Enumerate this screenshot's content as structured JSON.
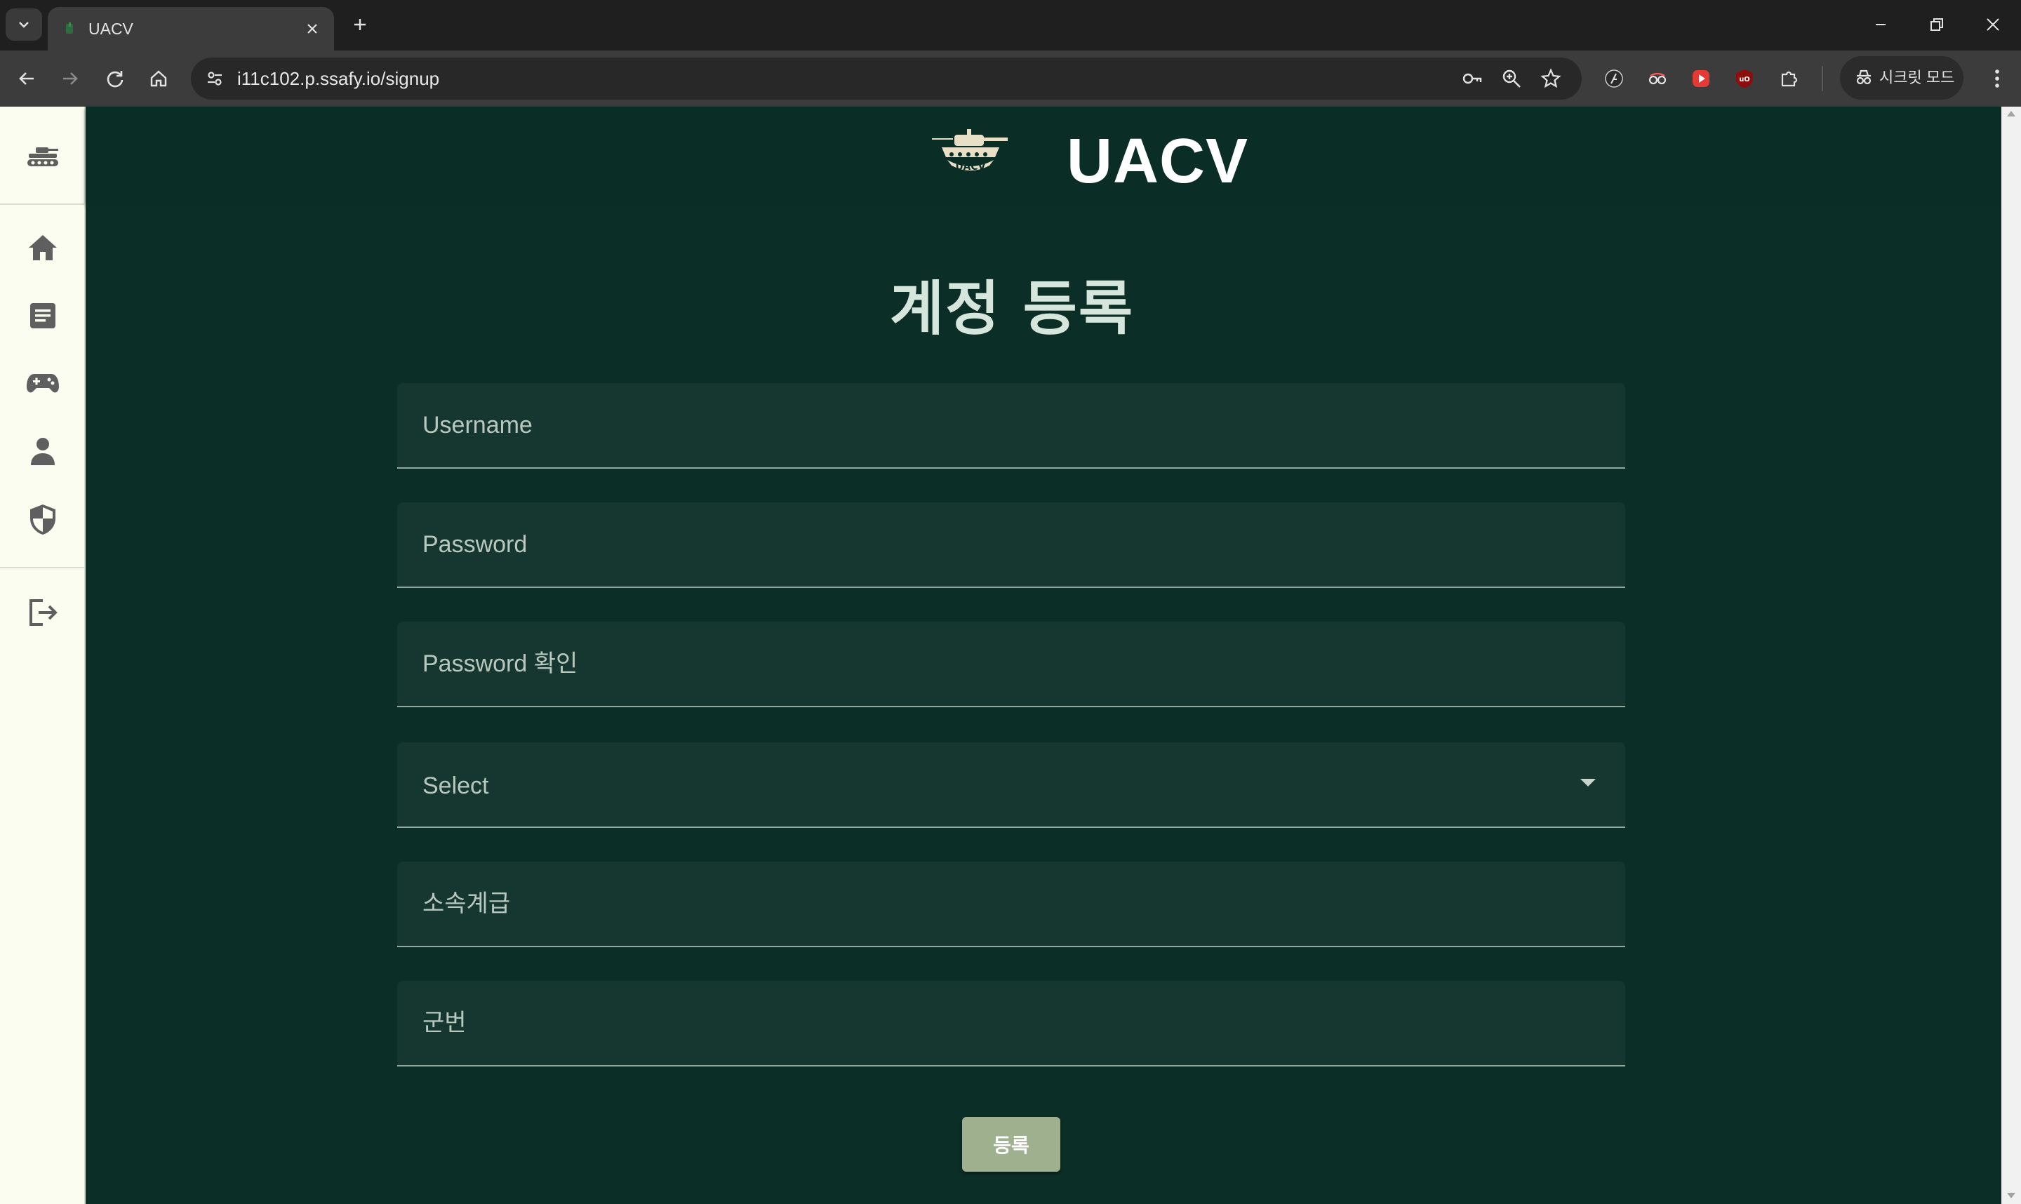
{
  "browser": {
    "tab_title": "UACV",
    "url": "i11c102.p.ssafy.io/signup",
    "incognito_label": "시크릿 모드",
    "icons": [
      "tab-search-icon",
      "close-icon",
      "plus-icon",
      "minimize-icon",
      "restore-icon",
      "window-close-icon",
      "back-icon",
      "forward-icon",
      "reload-icon",
      "home-icon",
      "site-settings-icon",
      "key-icon",
      "zoom-icon",
      "star-icon",
      "extension-icon",
      "puzzle-icon",
      "incognito-icon",
      "menu-dots-icon"
    ]
  },
  "header": {
    "brand": "UACV",
    "logo_text": "UACV"
  },
  "sidebar": {
    "items": [
      {
        "name": "tank-icon"
      },
      {
        "name": "home-icon"
      },
      {
        "name": "document-icon"
      },
      {
        "name": "gamepad-icon"
      },
      {
        "name": "person-icon"
      },
      {
        "name": "shield-icon"
      },
      {
        "name": "logout-icon"
      }
    ]
  },
  "form": {
    "title": "계정 등록",
    "username_placeholder": "Username",
    "password_placeholder": "Password",
    "password_confirm_placeholder": "Password 확인",
    "select_value": "Select",
    "unit_rank_placeholder": "소속계급",
    "service_number_placeholder": "군번",
    "submit_label": "등록"
  },
  "colors": {
    "page_bg": "#0b2e27",
    "field_bg": "#153730",
    "sidebar_bg": "#fcfdf1",
    "button_bg": "#9fb08f",
    "title_color": "#d6e6dc"
  }
}
